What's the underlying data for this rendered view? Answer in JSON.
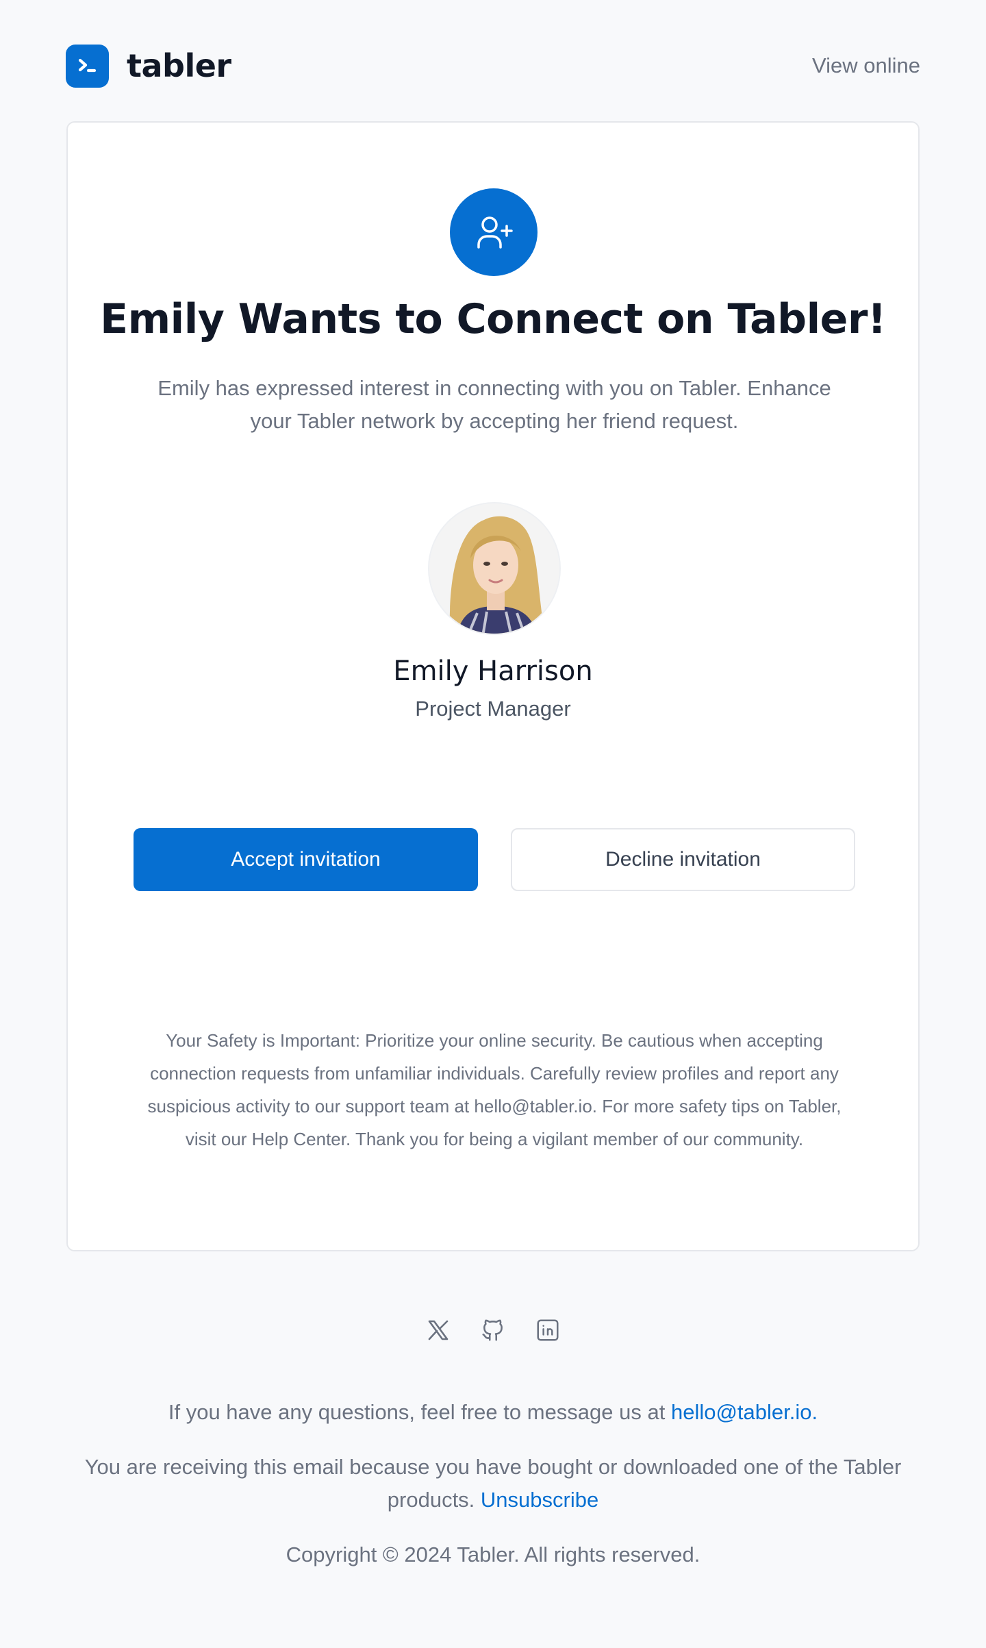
{
  "header": {
    "brand_name": "tabler",
    "view_online": "View online"
  },
  "card": {
    "title": "Emily Wants to Connect on Tabler!",
    "intro": "Emily has expressed interest in connecting with you on Tabler. Enhance your Tabler network by accepting her friend request.",
    "person": {
      "name": "Emily Harrison",
      "role": "Project Manager"
    },
    "accept_label": "Accept invitation",
    "decline_label": "Decline invitation",
    "safety": "Your Safety is Important: Prioritize your online security. Be cautious when accepting connection requests from unfamiliar individuals. Carefully review profiles and report any suspicious activity to our support team at hello@tabler.io. For more safety tips on Tabler, visit our Help Center. Thank you for being a vigilant member of our community."
  },
  "footer": {
    "socials": [
      "x-icon",
      "github-icon",
      "linkedin-icon"
    ],
    "questions_text": "If you have any questions, feel free to message us at ",
    "questions_email": "hello@tabler.io",
    "questions_end": ".",
    "receiving_text": "You are receiving this email because you have bought or downloaded one of the Tabler products. ",
    "unsubscribe": "Unsubscribe",
    "copyright": "Copyright © 2024 Tabler. All rights reserved."
  },
  "colors": {
    "primary": "#066fd1",
    "background": "#f8f9fb",
    "text_muted": "#6b7280"
  }
}
